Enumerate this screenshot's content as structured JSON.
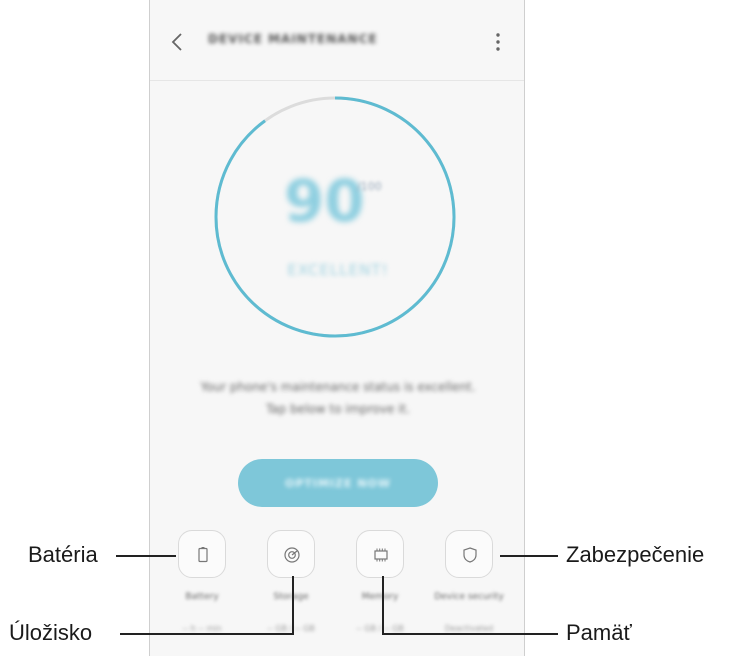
{
  "app_bar": {
    "title": "DEVICE MAINTENANCE",
    "back_icon": "chevron-left-icon",
    "more_icon": "more-vertical-icon"
  },
  "gauge": {
    "score": "90",
    "unit": "/100",
    "status": "EXCELLENT!",
    "progress_fraction": 0.9,
    "track_color": "#dcdcdc",
    "ring_color": "#5ebbd1"
  },
  "description": {
    "line1": "Your phone's maintenance status is excellent.",
    "line2": "Tap below to improve it."
  },
  "optimize_button": {
    "label": "OPTIMIZE NOW",
    "color": "#7ec7d9"
  },
  "tools": [
    {
      "label": "Battery",
      "sub": "-- h -- min",
      "icon": "battery-icon"
    },
    {
      "label": "Storage",
      "sub": "-- GB / -- GB",
      "icon": "storage-disc-icon"
    },
    {
      "label": "Memory",
      "sub": "-- GB / -- GB",
      "icon": "memory-chip-icon"
    },
    {
      "label": "Device security",
      "sub": "Deactivated",
      "icon": "shield-icon"
    }
  ],
  "callouts": {
    "battery": "Batéria",
    "storage": "Úložisko",
    "memory": "Pamäť",
    "security": "Zabezpečenie"
  }
}
